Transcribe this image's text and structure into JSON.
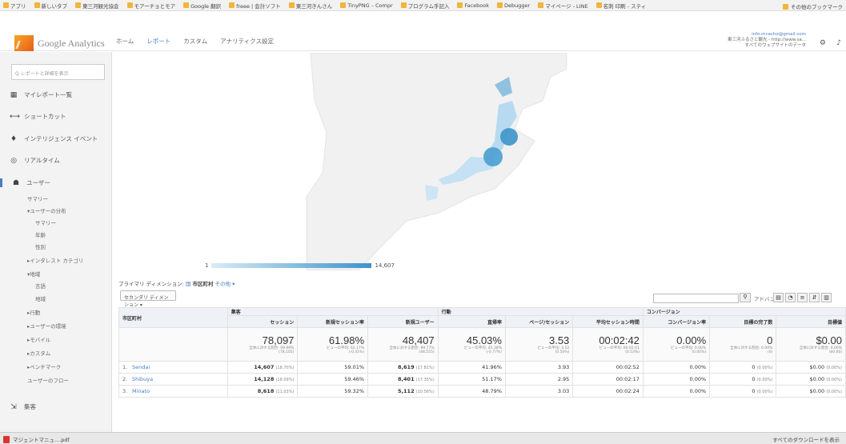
{
  "bookmarks": [
    "アプリ",
    "新しいタブ",
    "東三河観光協会",
    "モアーチョとモア",
    "Google 翻訳",
    "freee | 会計ソフト",
    "東三河きんさん",
    "TinyPNG – Compr",
    "プログラム手記入",
    "Facebook",
    "Debugger",
    "マイページ - LINE",
    "名刺 印刷 - スティ"
  ],
  "bookmarks_other": "その他のブックマーク",
  "app": {
    "logo_text": "Google Analytics"
  },
  "nav": [
    "ホーム",
    "レポート",
    "カスタム",
    "アナリティクス設定"
  ],
  "account": {
    "email": "info.mcacho@gmail.com",
    "line1": "東三河ふるさと観光 - http://www.sa...",
    "line2": "すべてのウェブサイトのデータ"
  },
  "sidebar": {
    "search_placeholder": "Q レポートと詳細を表示",
    "items": [
      "マイレポート一覧",
      "ショートカット",
      "インテリジェンス イベント",
      "リアルタイム",
      "ユーザー"
    ],
    "sub": [
      "サマリー",
      "▾ユーザーの分布",
      "サマリー",
      "年齢",
      "性別",
      "▸インタレスト カテゴリ",
      "▾地域",
      "言語",
      "地域",
      "▸行動",
      "▸ユーザーの環境",
      "▸モバイル",
      "▸カスタム",
      "▸ベンチマーク",
      "ユーザーのフロー"
    ],
    "bottom": "集客"
  },
  "map_legend": {
    "min": "1",
    "max": "14,607"
  },
  "primary_dim": {
    "label": "プライマリ ディメンション:",
    "opt1": "国",
    "opt2": "市区町村",
    "opt3": "その他 ▾"
  },
  "secondary_dim": "セカンダリ ディメンション ▾",
  "toolbar": {
    "advanced": "アドバンス"
  },
  "table": {
    "groups": {
      "acq": "集客",
      "beh": "行動",
      "conv": "コンバージョン"
    },
    "dim_header": "市区町村",
    "headers": [
      "セッション",
      "新規セッション率",
      "新規ユーザー",
      "直帰率",
      "ページ/セッション",
      "平均セッション時間",
      "コンバージョン率",
      "目標の完了数",
      "目標値"
    ],
    "totals": [
      {
        "v": "78,097",
        "s": "全体に対する割合: 99.99%",
        "s2": "(78,105)"
      },
      {
        "v": "61.98%",
        "s": "ビューの平均: 62.17%",
        "s2": "(-0.31%)"
      },
      {
        "v": "48,407",
        "s": "全体に対する割合: 99.77%",
        "s2": "(48,555)"
      },
      {
        "v": "45.03%",
        "s": "ビューの平均: 45.38%",
        "s2": "(-0.77%)"
      },
      {
        "v": "3.53",
        "s": "ビューの平均: 3.52",
        "s2": "(0.50%)"
      },
      {
        "v": "00:02:42",
        "s": "ビューの平均: 00:02:41",
        "s2": "(0.53%)"
      },
      {
        "v": "0.00%",
        "s": "ビューの平均: 0.00%",
        "s2": "(0.00%)"
      },
      {
        "v": "0",
        "s": "全体に対する割合: 0.00%",
        "s2": "(0)"
      },
      {
        "v": "$0.00",
        "s": "全体に対する割合: 0.00%",
        "s2": "($0.00)"
      }
    ],
    "rows": [
      {
        "n": "1.",
        "city": "Sendai",
        "c": [
          "14,607",
          "(18.70%)",
          "59.01%",
          "8,619",
          "(17.81%)",
          "41.96%",
          "3.93",
          "00:02:52",
          "0.00%",
          "0",
          "(0.00%)",
          "$0.00",
          "(0.00%)"
        ]
      },
      {
        "n": "2.",
        "city": "Shibuya",
        "c": [
          "14,128",
          "(18.09%)",
          "59.46%",
          "8,401",
          "(17.35%)",
          "51.17%",
          "2.95",
          "00:02:17",
          "0.00%",
          "0",
          "(0.00%)",
          "$0.00",
          "(0.00%)"
        ]
      },
      {
        "n": "3.",
        "city": "Minato",
        "c": [
          "8,618",
          "(11.03%)",
          "59.32%",
          "5,112",
          "(10.56%)",
          "48.79%",
          "3.03",
          "00:02:24",
          "0.00%",
          "0",
          "(0.00%)",
          "$0.00",
          "(0.00%)"
        ]
      }
    ]
  },
  "download": {
    "file": "マジェントマニュ....pdf",
    "all": "すべてのダウンロードを表示"
  }
}
